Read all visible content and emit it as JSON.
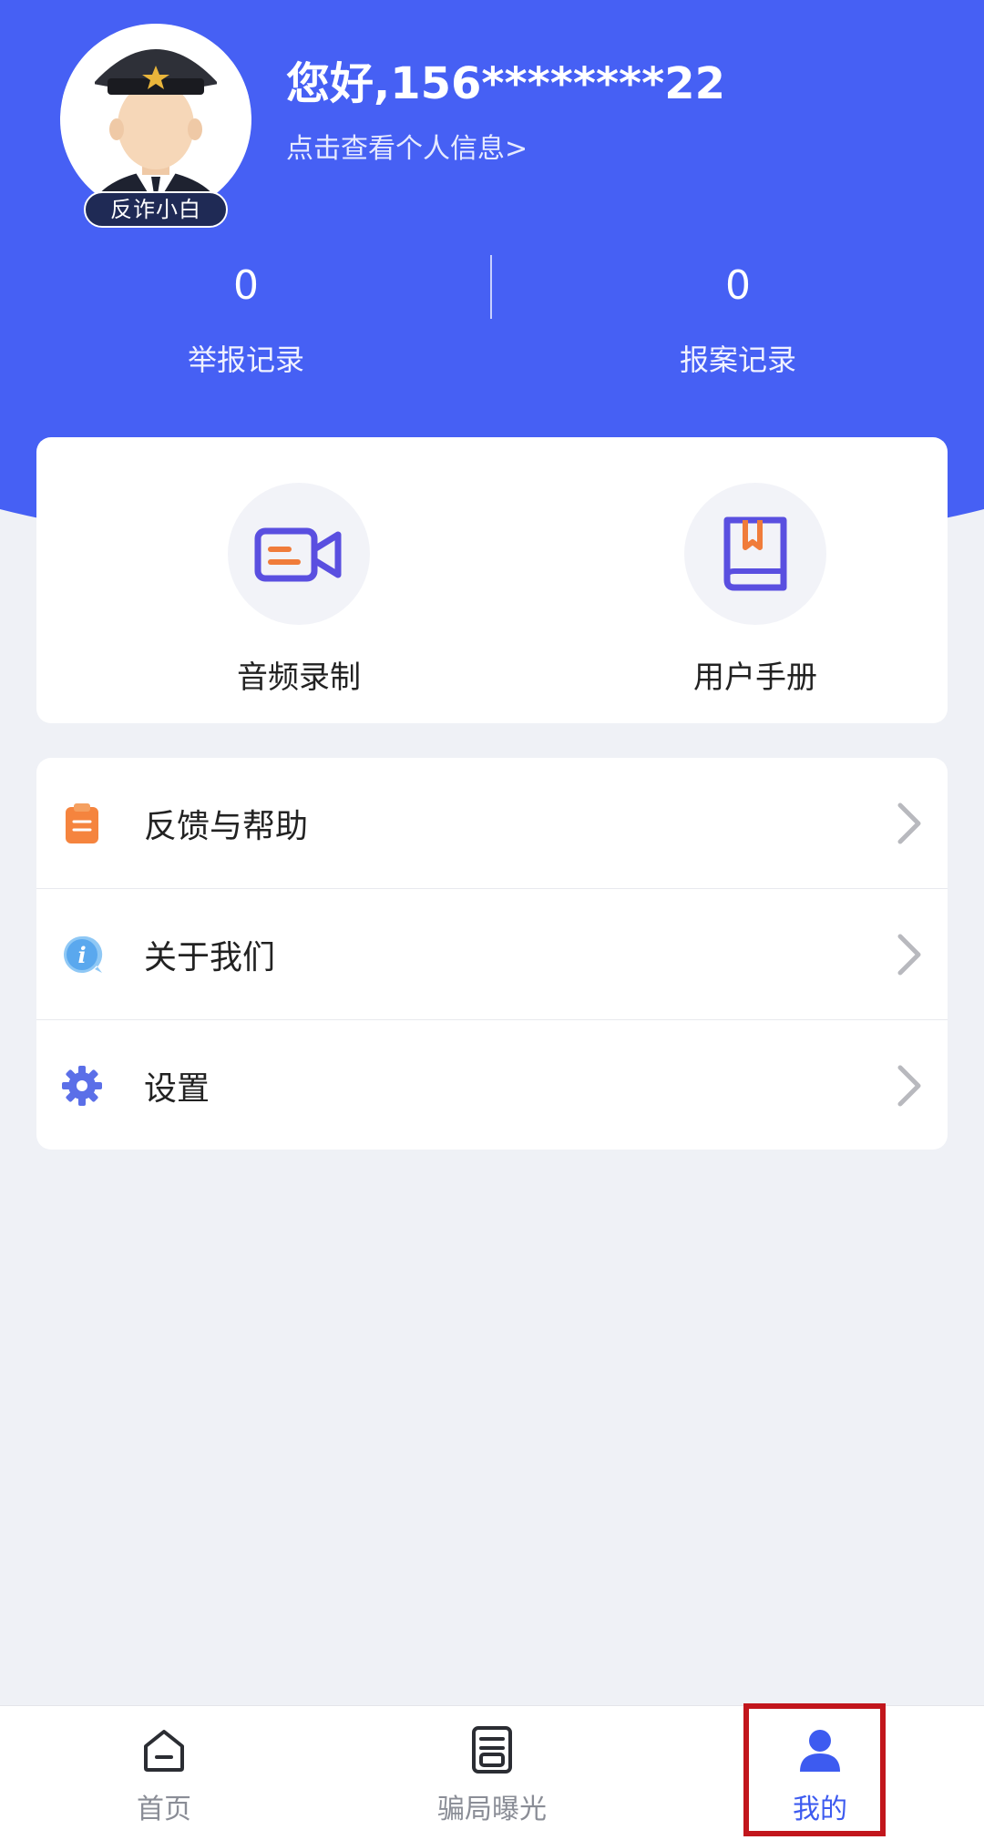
{
  "header": {
    "greeting": "您好,156********22",
    "profile_link": "点击查看个人信息>",
    "badge": "反诈小白",
    "bg_color": "#4660f4"
  },
  "stats": {
    "reports": {
      "value": "0",
      "label": "举报记录"
    },
    "cases": {
      "value": "0",
      "label": "报案记录"
    }
  },
  "quick_actions": {
    "audio": {
      "label": "音频录制",
      "icon": "video-camera-icon"
    },
    "manual": {
      "label": "用户手册",
      "icon": "book-icon"
    }
  },
  "menu": [
    {
      "label": "反馈与帮助",
      "icon": "clipboard-icon"
    },
    {
      "label": "关于我们",
      "icon": "info-bubble-icon"
    },
    {
      "label": "设置",
      "icon": "gear-icon"
    }
  ],
  "tabbar": {
    "home": "首页",
    "expose": "骗局曝光",
    "mine": "我的",
    "active": "mine",
    "active_color": "#3d5bf0"
  }
}
